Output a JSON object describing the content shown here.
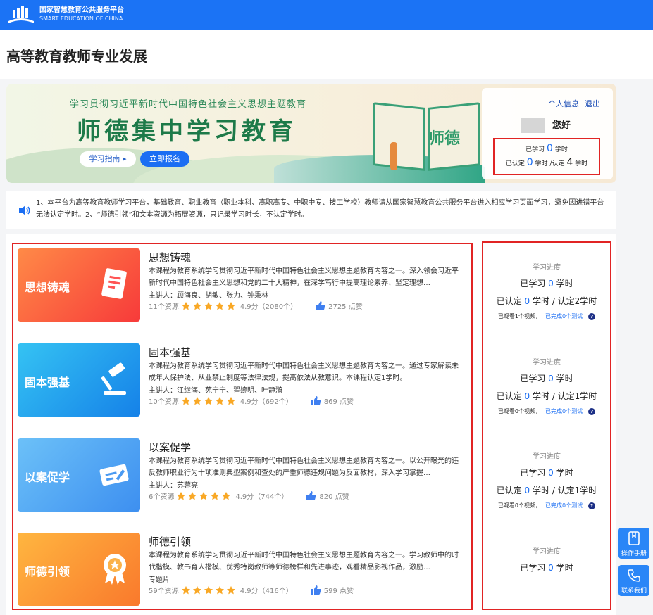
{
  "header": {
    "logo_cn": "国家智慧教育公共服务平台",
    "logo_en": "SMART EDUCATION OF CHINA"
  },
  "page_title": "高等教育教师专业发展",
  "banner": {
    "subtitle": "学习贯彻习近平新时代中国特色社会主义思想主题教育",
    "title": "师德集中学习教育",
    "book_text": "师德",
    "guide_label": "学习指南 ▸",
    "signup_label": "立即报名"
  },
  "user": {
    "profile_link": "个人信息",
    "logout_link": "退出",
    "greeting": "您好",
    "studied_prefix": "已学习",
    "studied_value": "0",
    "studied_unit": "学时",
    "certified_prefix": "已认定",
    "certified_value": "0",
    "certified_unit": "学时 /认定",
    "required_value": "4",
    "required_unit": "学时"
  },
  "notice": {
    "text": "1、本平台为高等教育教师学习平台，基础教育、职业教育（职业本科、高职高专、中职中专、技工学校）教师请从国家智慧教育公共服务平台进入相应学习页面学习，避免因进错平台无法认定学时。2、“师德引领”和文本资源为拓展资源，只记录学习时长，不认定学时。"
  },
  "courses": [
    {
      "thumb_label": "思想铸魂",
      "title": "思想铸魂",
      "desc": "本课程为教育系统学习贯彻习近平新时代中国特色社会主义思想主题教育内容之一。深入领会习近平新时代中国特色社会主义思想和党的二十大精神，在深学笃行中提高理论素养、坚定理想…",
      "teacher": "主讲人：顾海良、胡敏、张力、钟秉林",
      "resources": "11个资源",
      "score": "4.9分",
      "reviews": "（2080个）",
      "likes": "2725 点赞",
      "rating": 5,
      "color_a": "#ff8a47",
      "color_b": "#f73a3a"
    },
    {
      "thumb_label": "固本强基",
      "title": "固本强基",
      "desc": "本课程为教育系统学习贯彻习近平新时代中国特色社会主义思想主题教育内容之一。通过专家解读未成年人保护法、从业禁止制度等法律法规，提高依法从教意识。本课程认定1学时。",
      "teacher": "主讲人：江继海、苑宁宁、翟婉明、叶静漪",
      "resources": "10个资源",
      "score": "4.9分",
      "reviews": "（692个）",
      "likes": "869 点赞",
      "rating": 5,
      "color_a": "#35c3f3",
      "color_b": "#1581e8"
    },
    {
      "thumb_label": "以案促学",
      "title": "以案促学",
      "desc": "本课程为教育系统学习贯彻习近平新时代中国特色社会主义思想主题教育内容之一。以公开曝光的违反教师职业行为十项准则典型案例和查处的严重师德违规问题为反面教材，深入学习掌握…",
      "teacher": "主讲人：苏蓉亮",
      "resources": "6个资源",
      "score": "4.9分",
      "reviews": "（744个）",
      "likes": "820 点赞",
      "rating": 5,
      "color_a": "#6cc1f8",
      "color_b": "#3d8ff0"
    },
    {
      "thumb_label": "师德引领",
      "title": "师德引领",
      "desc": "本课程为教育系统学习贯彻习近平新时代中国特色社会主义思想主题教育内容之一。学习教师中的时代楷模、教书育人楷模、优秀特岗教师等师德榜样和先进事迹，观看精品影视作品，激励…",
      "teacher": "专题片",
      "resources": "59个资源",
      "score": "4.9分",
      "reviews": "（416个）",
      "likes": "599 点赞",
      "rating": 5,
      "color_a": "#ffb640",
      "color_b": "#f9792c"
    }
  ],
  "progress": [
    {
      "head": "学习进度",
      "studied_prefix": "已学习",
      "studied": "0",
      "studied_unit": "学时",
      "cert_prefix": "已认定",
      "cert": "0",
      "cert_suffix": "学时 / 认定2学时",
      "watched": "已观看1个视频，",
      "done": "已完成0个测试"
    },
    {
      "head": "学习进度",
      "studied_prefix": "已学习",
      "studied": "0",
      "studied_unit": "学时",
      "cert_prefix": "已认定",
      "cert": "0",
      "cert_suffix": "学时 / 认定1学时",
      "watched": "已观看0个视频，",
      "done": "已完成0个测试"
    },
    {
      "head": "学习进度",
      "studied_prefix": "已学习",
      "studied": "0",
      "studied_unit": "学时",
      "cert_prefix": "已认定",
      "cert": "0",
      "cert_suffix": "学时 / 认定1学时",
      "watched": "已观看0个视频，",
      "done": "已完成0个测试"
    },
    {
      "head": "学习进度",
      "studied_prefix": "已学习",
      "studied": "0",
      "studied_unit": "学时"
    }
  ],
  "help_glyph": "?",
  "floating": {
    "manual": "操作手册",
    "contact": "联系我们"
  },
  "colors": {
    "brand_blue": "#1b73f5",
    "highlight_red": "#e12424",
    "star_yellow": "#f9a825",
    "like_blue": "#3f7ff0"
  }
}
